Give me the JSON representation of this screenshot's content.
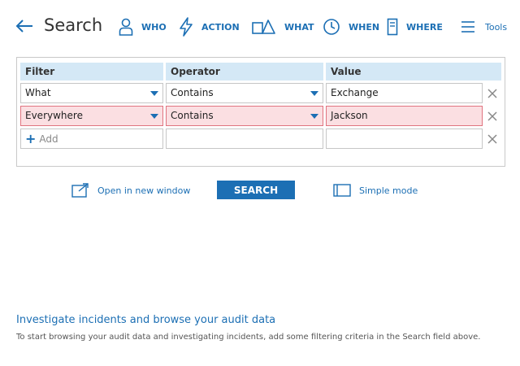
{
  "header": {
    "title": "Search",
    "nav": [
      {
        "id": "who",
        "label": "WHO",
        "icon": "person-icon"
      },
      {
        "id": "action",
        "label": "ACTION",
        "icon": "lightning-icon"
      },
      {
        "id": "what",
        "label": "WHAT",
        "icon": "shapes-icon"
      },
      {
        "id": "when",
        "label": "WHEN",
        "icon": "clock-icon"
      },
      {
        "id": "where",
        "label": "WHERE",
        "icon": "server-icon"
      }
    ],
    "tools_label": "Tools"
  },
  "filters": {
    "columns": {
      "filter": "Filter",
      "operator": "Operator",
      "value": "Value"
    },
    "rows": [
      {
        "filter": "What",
        "operator": "Contains",
        "value": "Exchange",
        "error": false
      },
      {
        "filter": "Everywhere",
        "operator": "Contains",
        "value": "Jackson",
        "error": true
      }
    ],
    "add_placeholder": "Add"
  },
  "actions": {
    "open_new_window": "Open in new window",
    "search": "SEARCH",
    "simple_mode": "Simple mode"
  },
  "info": {
    "title": "Investigate incidents and browse your audit data",
    "text": "To start browsing your audit data and investigating incidents, add some filtering criteria in the Search field above."
  },
  "colors": {
    "accent": "#1c6fb4",
    "header_bg": "#d4e8f6",
    "error_bg": "#fbdfe2",
    "error_border": "#e07480"
  }
}
